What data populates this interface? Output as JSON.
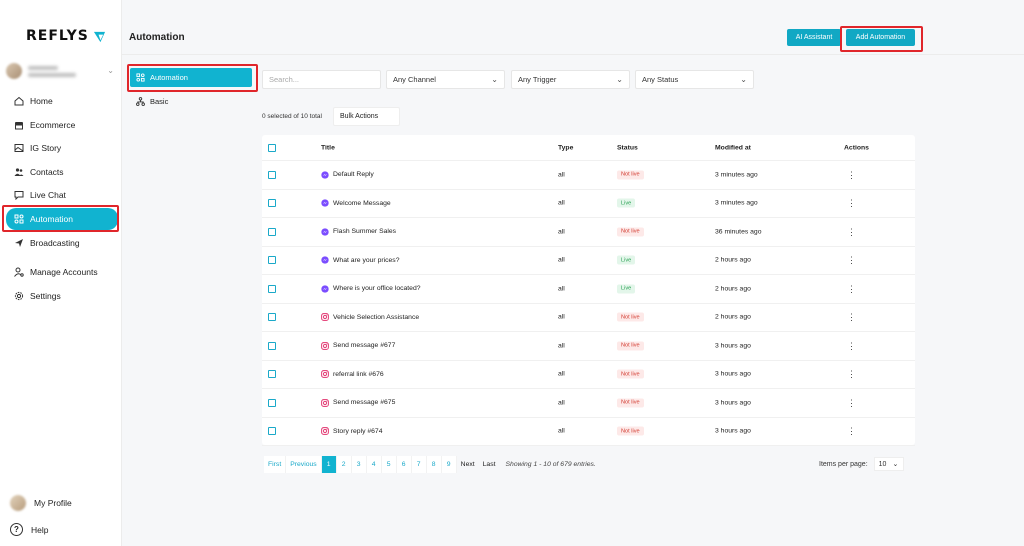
{
  "brand": {
    "name": "REFLYS"
  },
  "sidebar": {
    "items": [
      {
        "label": "Home",
        "icon": "home-icon"
      },
      {
        "label": "Ecommerce",
        "icon": "store-icon"
      },
      {
        "label": "IG Story",
        "icon": "image-icon"
      },
      {
        "label": "Contacts",
        "icon": "users-icon"
      },
      {
        "label": "Live Chat",
        "icon": "chat-icon"
      },
      {
        "label": "Automation",
        "icon": "automation-icon",
        "active": true
      },
      {
        "label": "Broadcasting",
        "icon": "send-icon"
      },
      {
        "label": "Manage Accounts",
        "icon": "user-gear-icon"
      },
      {
        "label": "Settings",
        "icon": "gear-icon"
      }
    ],
    "profile": "My Profile",
    "help": "Help"
  },
  "header": {
    "title": "Automation",
    "ai_button": "AI Assistant",
    "add_button": "Add Automation"
  },
  "subnav": {
    "items": [
      "Automation",
      "Basic"
    ]
  },
  "filters": {
    "search_placeholder": "Search...",
    "channel": "Any Channel",
    "trigger": "Any Trigger",
    "status": "Any Status"
  },
  "selection": {
    "info": "0 selected of 10 total",
    "bulk": "Bulk Actions"
  },
  "table": {
    "headers": {
      "title": "Title",
      "type": "Type",
      "status": "Status",
      "modified": "Modified at",
      "actions": "Actions"
    },
    "rows": [
      {
        "title": "Default Reply",
        "channel": "messenger",
        "type": "all",
        "status": "Not live",
        "modified": "3 minutes ago"
      },
      {
        "title": "Welcome Message",
        "channel": "messenger",
        "type": "all",
        "status": "Live",
        "modified": "3 minutes ago"
      },
      {
        "title": "Flash Summer Sales",
        "channel": "messenger",
        "type": "all",
        "status": "Not live",
        "modified": "36 minutes ago"
      },
      {
        "title": "What are your prices?",
        "channel": "messenger",
        "type": "all",
        "status": "Live",
        "modified": "2 hours ago"
      },
      {
        "title": "Where is your office located?",
        "channel": "messenger",
        "type": "all",
        "status": "Live",
        "modified": "2 hours ago"
      },
      {
        "title": "Vehicle Selection Assistance",
        "channel": "instagram",
        "type": "all",
        "status": "Not live",
        "modified": "2 hours ago"
      },
      {
        "title": "Send message #677",
        "channel": "instagram",
        "type": "all",
        "status": "Not live",
        "modified": "3 hours ago"
      },
      {
        "title": "referral link #676",
        "channel": "instagram",
        "type": "all",
        "status": "Not live",
        "modified": "3 hours ago"
      },
      {
        "title": "Send message #675",
        "channel": "instagram",
        "type": "all",
        "status": "Not live",
        "modified": "3 hours ago"
      },
      {
        "title": "Story reply #674",
        "channel": "instagram",
        "type": "all",
        "status": "Not live",
        "modified": "3 hours ago"
      }
    ]
  },
  "pagination": {
    "first": "First",
    "previous": "Previous",
    "pages": [
      "1",
      "2",
      "3",
      "4",
      "5",
      "6",
      "7",
      "8",
      "9"
    ],
    "current": "1",
    "next": "Next",
    "last": "Last",
    "info": "Showing 1 - 10 of 679 entries.",
    "per_page_label": "Items per page:",
    "per_page_value": "10"
  },
  "colors": {
    "accent": "#11b3d0",
    "highlight": "#e0262b",
    "live": "#2aa153",
    "not_live": "#d23a2f"
  }
}
